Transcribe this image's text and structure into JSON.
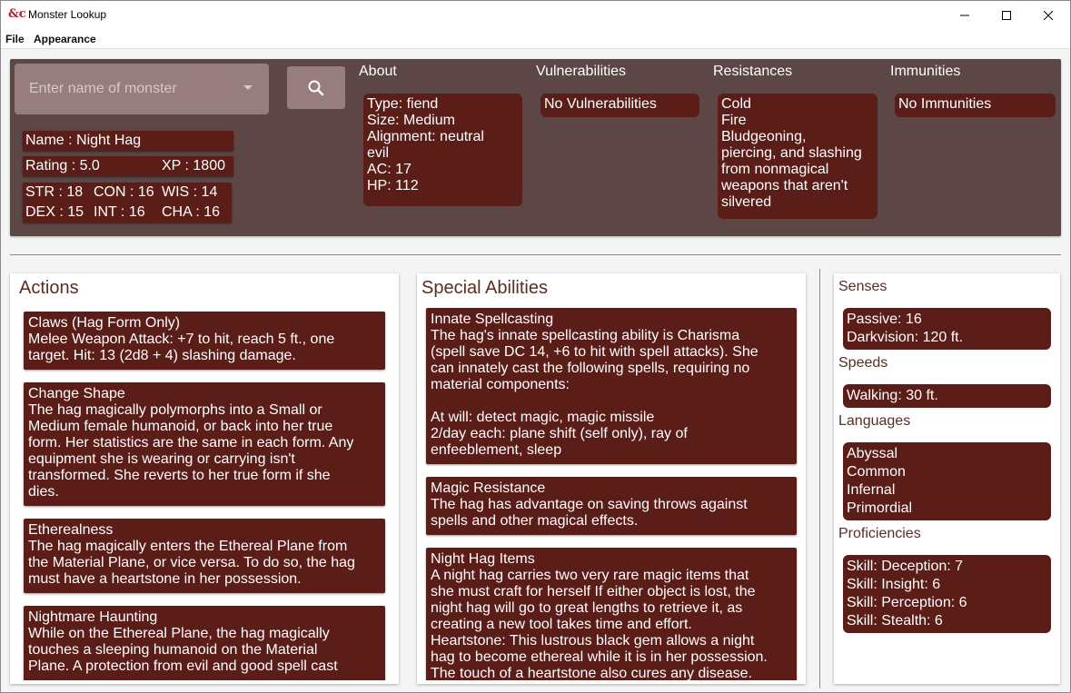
{
  "window": {
    "title": "Monster Lookup"
  },
  "menu": [
    "File",
    "Appearance"
  ],
  "search": {
    "placeholder": "Enter name of monster"
  },
  "monster": {
    "name": "Name : Night Hag",
    "rating": "Rating : 5.0",
    "xp": "XP : 1800",
    "str": "STR : 18",
    "con": "CON : 16",
    "wis": "WIS : 14",
    "dex": "DEX : 15",
    "int": "INT : 16",
    "cha": "CHA : 16"
  },
  "about": {
    "heading": "About",
    "lines": [
      "Type: fiend",
      "Size: Medium",
      "Alignment: neutral",
      "evil",
      "AC: 17",
      "HP: 112"
    ]
  },
  "vulnerabilities": {
    "heading": "Vulnerabilities",
    "lines": [
      "No Vulnerabilities"
    ]
  },
  "resistances": {
    "heading": "Resistances",
    "lines": [
      "Cold",
      "Fire",
      "Bludgeoning,",
      "piercing, and slashing",
      "from nonmagical",
      "weapons that aren't",
      "silvered"
    ]
  },
  "immunities": {
    "heading": "Immunities",
    "lines": [
      "No Immunities"
    ]
  },
  "actions": {
    "title": "Actions",
    "items": [
      {
        "lines": [
          "Claws (Hag Form Only)",
          "Melee Weapon Attack: +7 to hit, reach 5 ft., one",
          "target. Hit: 13 (2d8 + 4) slashing damage."
        ]
      },
      {
        "lines": [
          "Change Shape",
          "The hag magically polymorphs into a Small or",
          "Medium female humanoid, or back into her true",
          "form. Her statistics are the same in each form. Any",
          "equipment she is wearing or carrying isn't",
          "transformed. She reverts to her true form if she",
          "dies."
        ]
      },
      {
        "lines": [
          "Etherealness",
          "The hag magically enters the Ethereal Plane from",
          "the Material Plane, or vice versa. To do so, the hag",
          "must have a heartstone in her possession."
        ]
      },
      {
        "lines": [
          "Nightmare Haunting",
          "While on the Ethereal Plane, the hag magically",
          "touches a sleeping humanoid on the Material",
          "Plane. A protection from evil and good spell cast"
        ]
      }
    ]
  },
  "special": {
    "title": "Special Abilities",
    "items": [
      {
        "lines": [
          "Innate Spellcasting",
          "The hag's innate spellcasting ability is Charisma",
          "(spell save DC 14, +6 to hit with spell attacks). She",
          "can innately cast the following spells, requiring no",
          "material components:",
          "",
          "At will: detect magic, magic missile",
          "2/day each: plane shift (self only), ray of",
          "enfeeblement, sleep"
        ]
      },
      {
        "lines": [
          "Magic Resistance",
          "The hag has advantage on saving throws against",
          "spells and other magical effects."
        ]
      },
      {
        "lines": [
          "Night Hag Items",
          "A night hag carries two very rare magic items that",
          "she must craft for herself If either object is lost, the",
          "night hag will go to great lengths to retrieve it, as",
          "creating a new tool takes time and effort.",
          "Heartstone: This lustrous black gem allows a night",
          "hag to become ethereal while it is in her possession.",
          "The touch of a heartstone also cures any disease."
        ]
      }
    ]
  },
  "senses": {
    "heading": "Senses",
    "lines": [
      "Passive: 16",
      "Darkvision: 120 ft."
    ]
  },
  "speeds": {
    "heading": "Speeds",
    "lines": [
      "Walking: 30 ft."
    ]
  },
  "languages": {
    "heading": "Languages",
    "lines": [
      "Abyssal",
      "Common",
      "Infernal",
      "Primordial"
    ]
  },
  "proficiencies": {
    "heading": "Proficiencies",
    "lines": [
      "Skill: Deception: 7",
      "Skill: Insight: 6",
      "Skill: Perception: 6",
      "Skill: Stealth: 6"
    ]
  }
}
